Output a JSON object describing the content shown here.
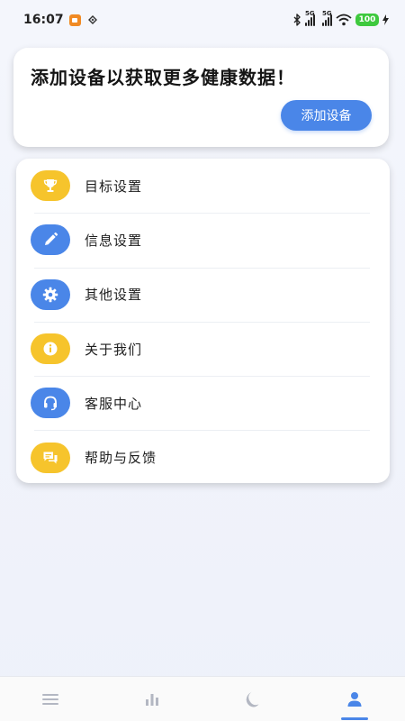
{
  "status_bar": {
    "time": "16:07",
    "network_left": "5G",
    "network_right": "5G",
    "battery": "100",
    "battery_color": "#3ec93e"
  },
  "device_card": {
    "title": "添加设备以获取更多健康数据！",
    "add_button_label": "添加设备"
  },
  "menu": {
    "items": [
      {
        "label": "目标设置",
        "icon": "trophy-icon",
        "color": "#f6c42c"
      },
      {
        "label": "信息设置",
        "icon": "pencil-icon",
        "color": "#4a86e8"
      },
      {
        "label": "其他设置",
        "icon": "gear-icon",
        "color": "#4a86e8"
      },
      {
        "label": "关于我们",
        "icon": "info-icon",
        "color": "#f6c42c"
      },
      {
        "label": "客服中心",
        "icon": "headset-icon",
        "color": "#4a86e8"
      },
      {
        "label": "帮助与反馈",
        "icon": "chat-icon",
        "color": "#f6c42c"
      }
    ]
  },
  "bottom_nav": {
    "items": [
      {
        "icon": "menu-icon",
        "active": false
      },
      {
        "icon": "bar-chart-icon",
        "active": false
      },
      {
        "icon": "moon-icon",
        "active": false
      },
      {
        "icon": "person-icon",
        "active": true
      }
    ],
    "active_color": "#4a86e8",
    "inactive_color": "#b3b7c2"
  },
  "colors": {
    "accent": "#4a86e8",
    "yellow": "#f6c42c"
  }
}
